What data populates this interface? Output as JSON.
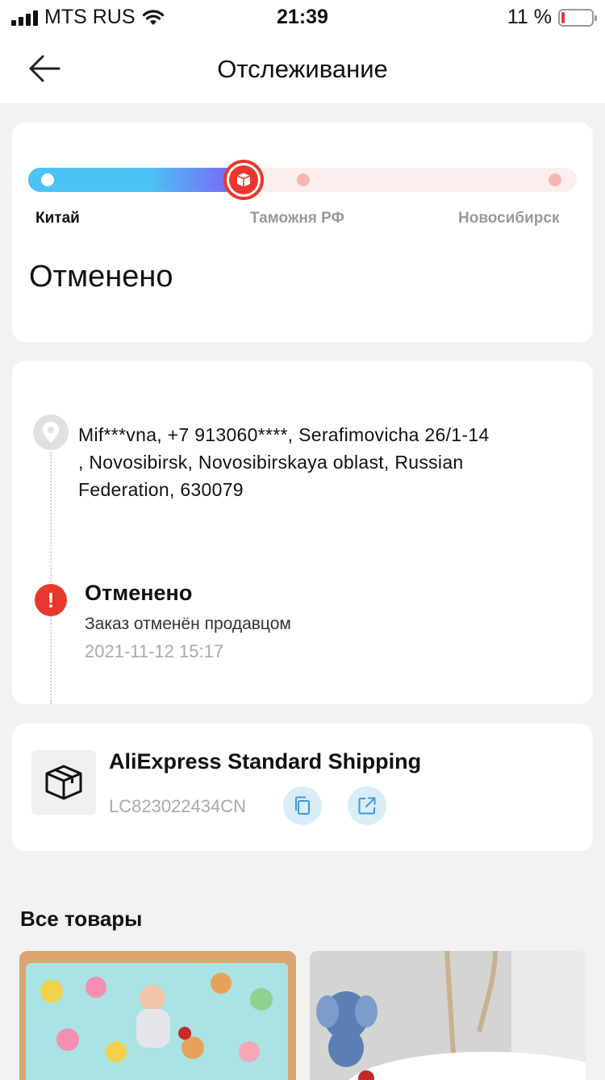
{
  "status_bar": {
    "carrier": "MTS RUS",
    "time": "21:39",
    "battery": "11 %",
    "battery_level": 0.11
  },
  "nav": {
    "title": "Отслеживание"
  },
  "progress": {
    "stages": [
      "Китай",
      "Таможня РФ",
      "Новосибирск"
    ],
    "status": "Отменено",
    "colors": {
      "accent": "#e8382d",
      "track_start": "#4cc3f5",
      "track_end": "#8b5cf6"
    }
  },
  "timeline": {
    "address": "Mif***vna,  +7 913060****,  Serafimovicha 26/1-14 ,  Novosibirsk,  Novosibirskaya oblast,  Russian Federation,  630079",
    "event": {
      "title": "Отменено",
      "description": "Заказ отменён продавцом",
      "timestamp": "2021-11-12 15:17"
    }
  },
  "shipping": {
    "name": "AliExpress Standard Shipping",
    "tracking_number": "LC823022434CN"
  },
  "section": {
    "title": "Все товары"
  }
}
